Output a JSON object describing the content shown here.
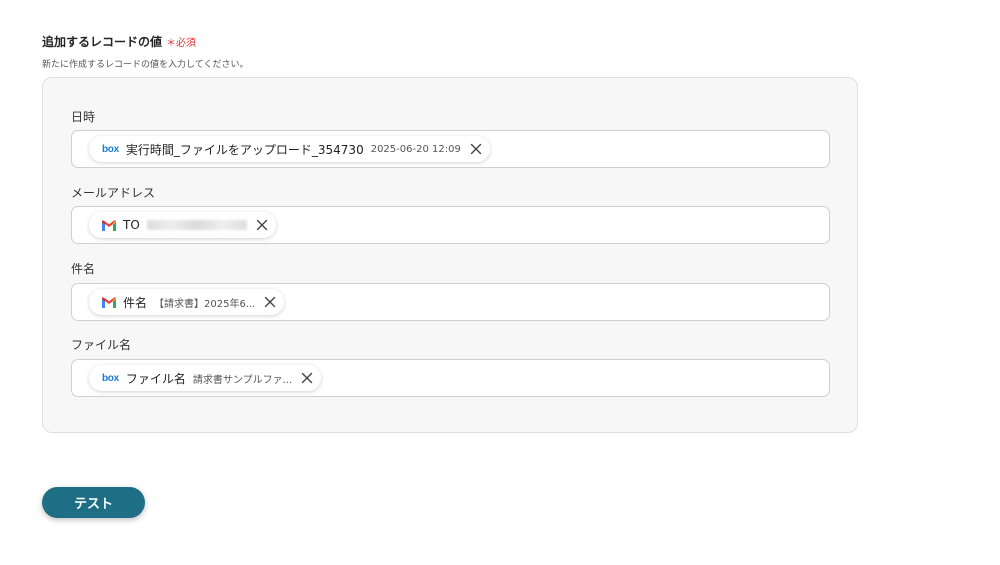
{
  "section": {
    "title": "追加するレコードの値",
    "required_label": "＊必須",
    "description": "新たに作成するレコードの値を入力してください。"
  },
  "fields": [
    {
      "label": "日時",
      "chip": {
        "icon": "box-icon",
        "icon_text": "box",
        "main": "実行時間_ファイルをアップロード_354730",
        "sub": "2025-06-20 12:09"
      }
    },
    {
      "label": "メールアドレス",
      "chip": {
        "icon": "gmail-icon",
        "main": "TO",
        "sub": ""
      }
    },
    {
      "label": "件名",
      "chip": {
        "icon": "gmail-icon",
        "main": "件名",
        "sub": "【請求書】2025年6..."
      }
    },
    {
      "label": "ファイル名",
      "chip": {
        "icon": "box-icon",
        "icon_text": "box",
        "main": "ファイル名",
        "sub": "請求書サンプルファ..."
      }
    }
  ],
  "buttons": {
    "test_label": "テスト"
  },
  "colors": {
    "accent": "#1e6f86",
    "required": "#e5323b",
    "box_brand": "#1a7bd6"
  }
}
